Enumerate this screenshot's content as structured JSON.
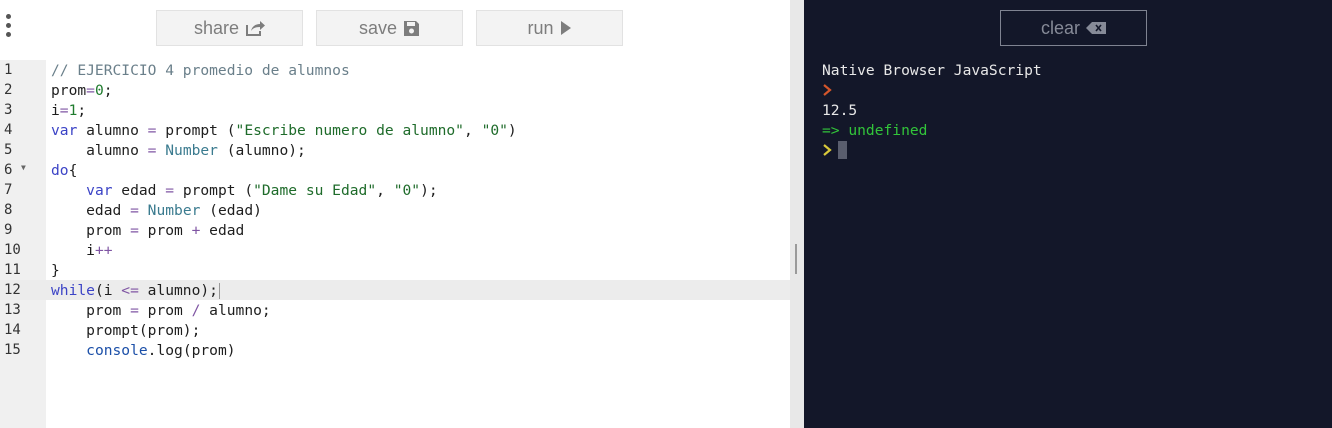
{
  "toolbar": {
    "share_label": "share",
    "save_label": "save",
    "run_label": "run",
    "share_icon": "share-arrow-icon",
    "save_icon": "floppy-disk-icon",
    "run_icon": "play-icon",
    "menu_icon": "kebab-menu-icon"
  },
  "editor": {
    "active_line": 12,
    "lines": [
      {
        "n": "1",
        "text": "// EJERCICIO 4 promedio de alumnos"
      },
      {
        "n": "2",
        "text": "prom=0;"
      },
      {
        "n": "3",
        "text": "i=1;"
      },
      {
        "n": "4",
        "text": "var alumno = prompt (\"Escribe numero de alumno\", \"0\")"
      },
      {
        "n": "5",
        "text": "    alumno = Number (alumno);"
      },
      {
        "n": "6",
        "text": "do{"
      },
      {
        "n": "7",
        "text": "    var edad = prompt (\"Dame su Edad\", \"0\");"
      },
      {
        "n": "8",
        "text": "    edad = Number (edad)"
      },
      {
        "n": "9",
        "text": "    prom = prom + edad"
      },
      {
        "n": "10",
        "text": "    i++"
      },
      {
        "n": "11",
        "text": "}"
      },
      {
        "n": "12",
        "text": "while(i <= alumno);"
      },
      {
        "n": "13",
        "text": "    prom = prom / alumno;"
      },
      {
        "n": "14",
        "text": "    prompt(prom);"
      },
      {
        "n": "15",
        "text": "    console.log(prom)"
      }
    ]
  },
  "console": {
    "clear_label": "clear",
    "clear_icon": "backspace-icon",
    "title": "Native Browser JavaScript",
    "output_value": "12.5",
    "result_text": "=> undefined",
    "colors": {
      "background": "#131729",
      "prompt_red": "#d4562b",
      "prompt_yellow": "#d9c93a",
      "result_green": "#32c43a"
    }
  }
}
